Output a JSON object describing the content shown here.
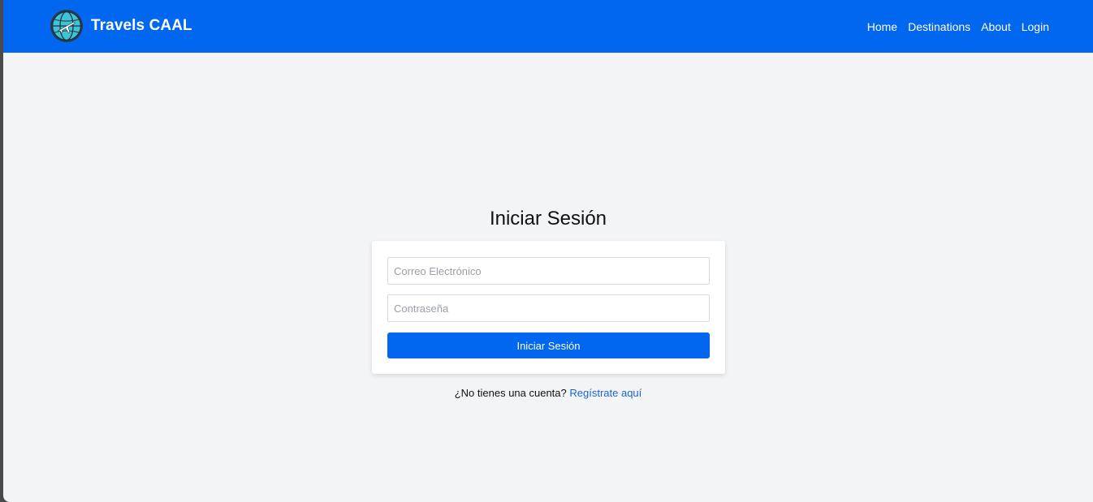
{
  "header": {
    "brand_name": "Travels CAAL",
    "logo_icon": "globe-airplane-icon",
    "nav": [
      {
        "label": "Home"
      },
      {
        "label": "Destinations"
      },
      {
        "label": "About"
      },
      {
        "label": "Login"
      }
    ]
  },
  "login": {
    "title": "Iniciar Sesión",
    "email": {
      "value": "",
      "placeholder": "Correo Electrónico"
    },
    "password": {
      "value": "",
      "placeholder": "Contraseña"
    },
    "submit_label": "Iniciar Sesión",
    "register_prompt": "¿No tienes una cuenta?",
    "register_link": "Regístrate aquí"
  },
  "colors": {
    "brand": "#0067ee",
    "background": "#f3f4f6",
    "link": "#1a64d6"
  }
}
